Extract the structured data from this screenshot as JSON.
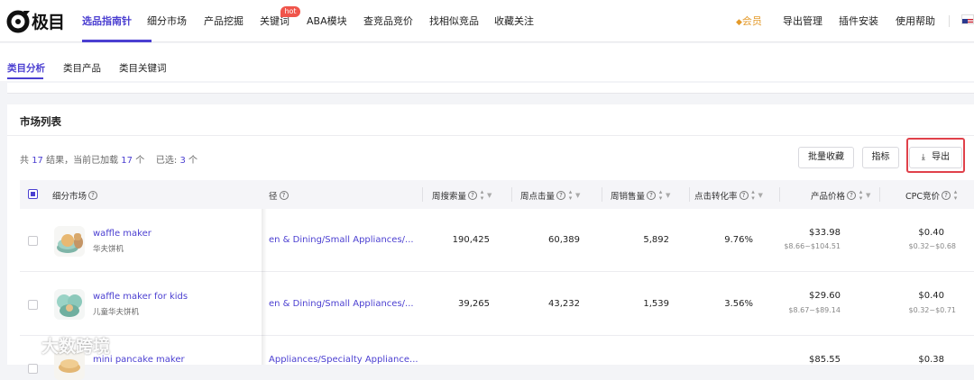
{
  "nav": {
    "logo_text": "极目",
    "items": [
      "选品指南针",
      "细分市场",
      "产品挖掘",
      "关键词",
      "ABA模块",
      "查竞品竞价",
      "找相似竞品",
      "收藏关注"
    ],
    "hot_badge": "hot",
    "right_items": [
      "会员",
      "导出管理",
      "插件安装",
      "使用帮助"
    ],
    "vip_icon": "diamond-icon"
  },
  "subnav": {
    "tabs": [
      "类目分析",
      "类目产品",
      "类目关键词"
    ]
  },
  "panel": {
    "title": "市场列表",
    "summary": {
      "prefix": "共 ",
      "total": "17",
      "mid": " 结果，当前已加载 ",
      "loaded": "17",
      "mid2": " 个    已选: ",
      "selected": "3",
      "suffix": " 个"
    },
    "buttons": {
      "batch_collect": "批量收藏",
      "metrics": "指标",
      "export": "导出"
    }
  },
  "table": {
    "columns": [
      "细分市场",
      "径",
      "周搜索量",
      "周点击量",
      "周销售量",
      "点击转化率",
      "产品价格",
      "CPC竞价"
    ],
    "rows": [
      {
        "keyword": "waffle maker",
        "keyword_cn": "华夫饼机",
        "path": "en & Dining/Small Appliances/...",
        "search": "190,425",
        "clicks": "60,389",
        "sales": "5,892",
        "cvr": "9.76%",
        "price": "$33.98",
        "price_range": "$8.66~$104.51",
        "cpc": "$0.40",
        "cpc_range": "$0.32~$0.68"
      },
      {
        "keyword": "waffle maker for kids",
        "keyword_cn": "儿童华夫饼机",
        "path": "en & Dining/Small Appliances/...",
        "search": "39,265",
        "clicks": "43,232",
        "sales": "1,539",
        "cvr": "3.56%",
        "price": "$29.60",
        "price_range": "$8.67~$89.14",
        "cpc": "$0.40",
        "cpc_range": "$0.32~$0.71"
      },
      {
        "keyword": "mini pancake maker",
        "keyword_cn": "",
        "path": "Appliances/Specialty Appliance...",
        "search": "",
        "clicks": "",
        "sales": "",
        "cvr": "",
        "price": "$85.55",
        "price_range": "",
        "cpc": "$0.38",
        "cpc_range": ""
      }
    ]
  },
  "watermark": "大数跨境",
  "colors": {
    "accent": "#4b3fd1",
    "hot": "#f0554b",
    "vip": "#e49a2a",
    "export_frame": "#e0414a"
  }
}
